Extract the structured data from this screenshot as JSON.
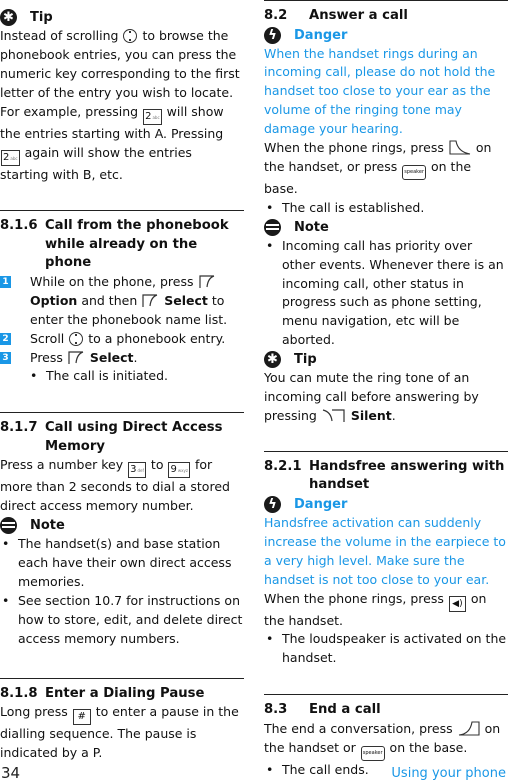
{
  "colors": {
    "accent": "#1a97e6",
    "text": "#111111",
    "icon_bg": "#1a1a1a"
  },
  "left": {
    "tip1": {
      "label": "Tip",
      "p1": "Instead of scrolling",
      "p2": "to browse the phonebook entries, you can press the numeric key corresponding to the first letter of the entry you wish to locate. For example, pressing",
      "p3": "will show the entries starting with A. Pressing",
      "p4": "again will show the entries starting with B, etc.",
      "key": "2",
      "key_sub": "abc"
    },
    "s816": {
      "num": "8.1.6",
      "title": "Call from the phonebook while already on the phone",
      "steps": [
        {
          "n": "1",
          "a": "While on the phone, press",
          "b": "Option",
          "c": "and then",
          "d": "Select",
          "e": "to enter the phonebook name list."
        },
        {
          "n": "2",
          "a": "Scroll",
          "b": "to a phonebook entry."
        },
        {
          "n": "3",
          "a": "Press",
          "b": "Select",
          "c": "."
        }
      ],
      "bullet": "The call is initiated."
    },
    "s817": {
      "num": "8.1.7",
      "title": "Call using Direct Access Memory",
      "p1": "Press a number key",
      "key1": "3",
      "key1_sub": "def",
      "p2": "to",
      "key2": "9",
      "key2_sub": "wxyz",
      "p3": "for more than 2 seconds to dial a stored direct access memory number.",
      "note_label": "Note",
      "bullets": [
        "The handset(s) and base station each have their own direct access memories.",
        "See section 10.7 for instructions on how to store, edit, and delete direct access memory numbers."
      ]
    },
    "s818": {
      "num": "8.1.8",
      "title": "Enter a Dialing Pause",
      "p1": "Long press",
      "key": "#",
      "p2": "to enter a pause in the dialling sequence. The pause is indicated by a P."
    }
  },
  "right": {
    "s82": {
      "num": "8.2",
      "title": "Answer a call",
      "danger_label": "Danger",
      "danger_text": "When the handset rings during an incoming call, please do not hold the handset too close to your ear as the volume of the ringing tone may damage your hearing.",
      "p1": "When the phone rings, press",
      "p2": "on the handset, or press",
      "p3": "on the base.",
      "speaker_label": "speaker",
      "talk_label": "TALK",
      "bullet": "The call is established.",
      "note_label": "Note",
      "note_bullet": "Incoming call has priority over other events. Whenever there is an incoming call, other status in progress such as phone setting, menu navigation, etc will be aborted.",
      "tip_label": "Tip",
      "tip_p1": "You can mute the ring tone of an incoming call before answering by pressing",
      "tip_bold": "Silent",
      "tip_end": "."
    },
    "s821": {
      "num": "8.2.1",
      "title": "Handsfree answering with handset",
      "danger_label": "Danger",
      "danger_text": "Handsfree activation can suddenly increase the volume in the earpiece to a very high level. Make sure the handset is not too close to your ear.",
      "p1": "When the phone rings, press",
      "p2": "on the handset.",
      "bullet": "The loudspeaker is activated on the handset."
    },
    "s83": {
      "num": "8.3",
      "title": "End a call",
      "p1": "The end a conversation, press",
      "p2": "on the handset or",
      "p3": "on the base.",
      "end_label": "END",
      "speaker_label": "speaker",
      "bullet": "The call ends."
    }
  },
  "footer": {
    "page_number": "34",
    "section_title": "Using your phone"
  }
}
